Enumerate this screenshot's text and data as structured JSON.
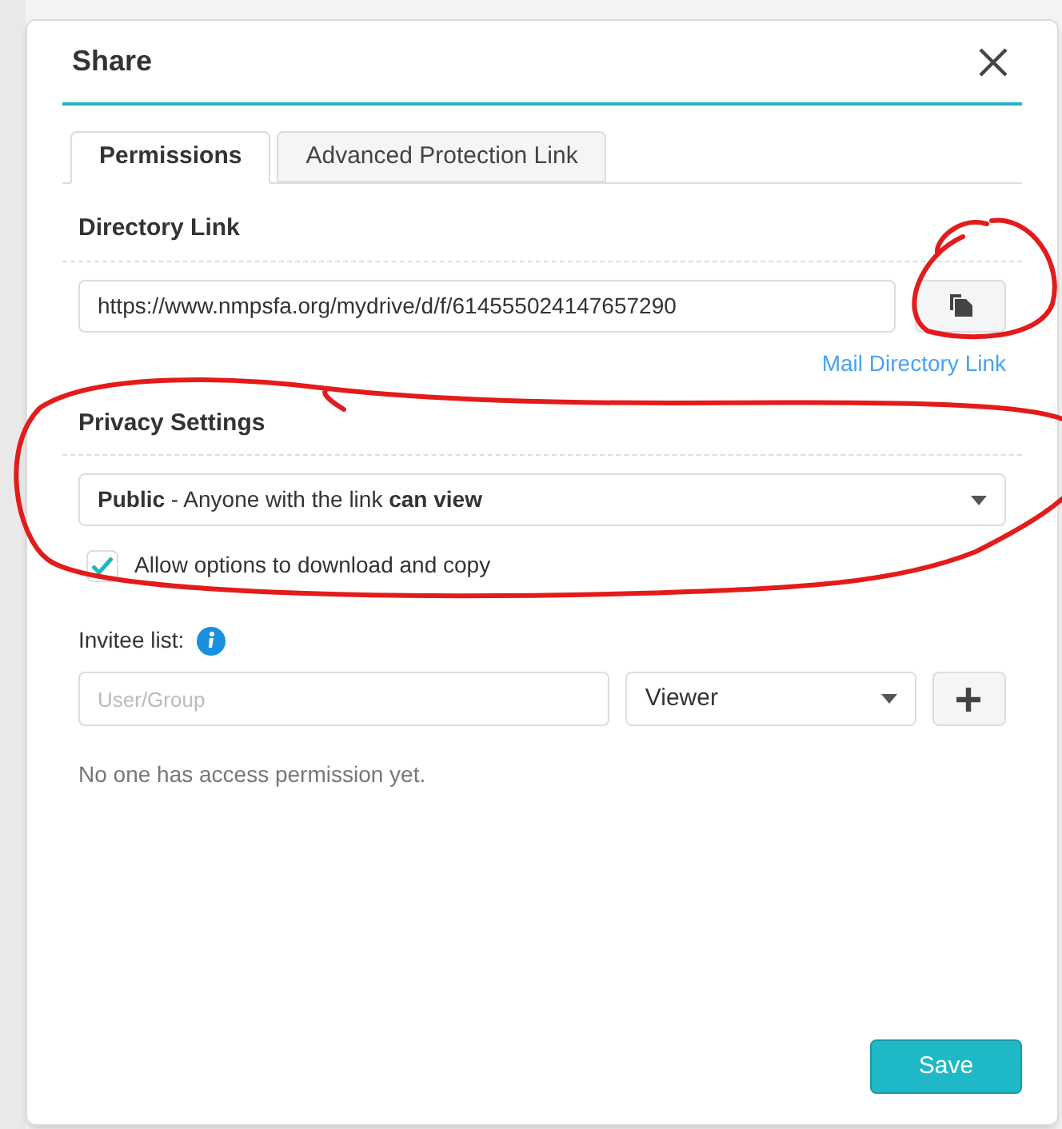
{
  "dialog": {
    "title": "Share"
  },
  "tabs": [
    {
      "label": "Permissions",
      "selected": true
    },
    {
      "label": "Advanced Protection Link",
      "selected": false
    }
  ],
  "directory_link": {
    "heading": "Directory Link",
    "url": "https://www.nmpsfa.org/mydrive/d/f/614555024147657290",
    "mail_link": "Mail Directory Link"
  },
  "privacy_settings": {
    "heading": "Privacy Settings",
    "selection": "**Public** - Anyone with the link **can view**",
    "allow_download": {
      "label": "Allow options to download and copy",
      "checked": true
    }
  },
  "invitees": {
    "label": "Invitee list:",
    "user_placeholder": "User/Group",
    "role": "Viewer",
    "empty_message": "No one has access permission yet."
  },
  "buttons": {
    "save": "Save"
  }
}
